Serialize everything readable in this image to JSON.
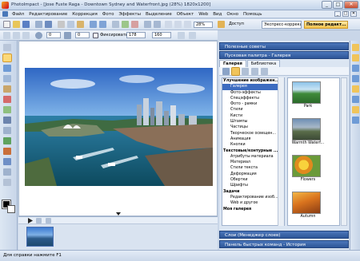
{
  "window": {
    "title": "PhotoImpact - [Jose Fuste Raga - Downtown Sydney and Waterfront.jpg (28%) 1820x1200]",
    "controls": [
      "_",
      "□",
      "✕"
    ]
  },
  "menubar": {
    "items": [
      "Файл",
      "Редактирование",
      "Коррекция",
      "Фото",
      "Эффекты",
      "Выделение",
      "Объект",
      "Web",
      "Вид",
      "Окно",
      "Помощь"
    ],
    "window_controls": [
      "_",
      "□",
      "✕"
    ]
  },
  "toolbar": {
    "zoom": "28%",
    "access_label": "Доступ",
    "express_correction": "Экспресс-коррекция",
    "full_editor": "Полное редакт..."
  },
  "toolbar2": {
    "field1": "0",
    "field2": "0",
    "fix_label": "Фиксировать",
    "width": "178",
    "height": "160"
  },
  "status": {
    "text": "Для справки нажмите F1"
  },
  "right_panel": {
    "useful_tips": "Полезные советы",
    "library_header": "Пусковая палитра - Галерея",
    "tabs": [
      "Галерея",
      "Библиотека"
    ],
    "tree": [
      {
        "label": "Улучшение изображен...",
        "type": "group"
      },
      {
        "label": "Галерея",
        "type": "child",
        "selected": true
      },
      {
        "label": "Фото-эффекты",
        "type": "child"
      },
      {
        "label": "Спецэффекты",
        "type": "child"
      },
      {
        "label": "Фото - рамки",
        "type": "child"
      },
      {
        "label": "Стили",
        "type": "child"
      },
      {
        "label": "Кисти",
        "type": "child"
      },
      {
        "label": "Штампы",
        "type": "child"
      },
      {
        "label": "Частицы",
        "type": "child"
      },
      {
        "label": "Творческое освещен...",
        "type": "child"
      },
      {
        "label": "Анимация",
        "type": "child"
      },
      {
        "label": "Кнопки",
        "type": "child"
      },
      {
        "label": "Текстовые/контурные ...",
        "type": "group"
      },
      {
        "label": "Атрибуты материала",
        "type": "child"
      },
      {
        "label": "Материал",
        "type": "child"
      },
      {
        "label": "Стили текста",
        "type": "child"
      },
      {
        "label": "Деформация",
        "type": "child"
      },
      {
        "label": "Обертки",
        "type": "child"
      },
      {
        "label": "Шрифты",
        "type": "child"
      },
      {
        "label": "Задачи",
        "type": "group"
      },
      {
        "label": "Редактирование изоб...",
        "type": "child"
      },
      {
        "label": "Web и другое",
        "type": "child"
      },
      {
        "label": "Моя галерея",
        "type": "group"
      }
    ],
    "thumbnails": [
      "Park",
      "Warmth Waterf...",
      "Flowers",
      "Autumn"
    ],
    "layers_header": "Слои (Менеджер слоев)",
    "quick_panel_header": "Панель быстрых команд - История"
  },
  "colors": {
    "panel_header": "#3a64a8",
    "selected": "#3d6cc0",
    "workspace_bg": "#ffffff"
  }
}
